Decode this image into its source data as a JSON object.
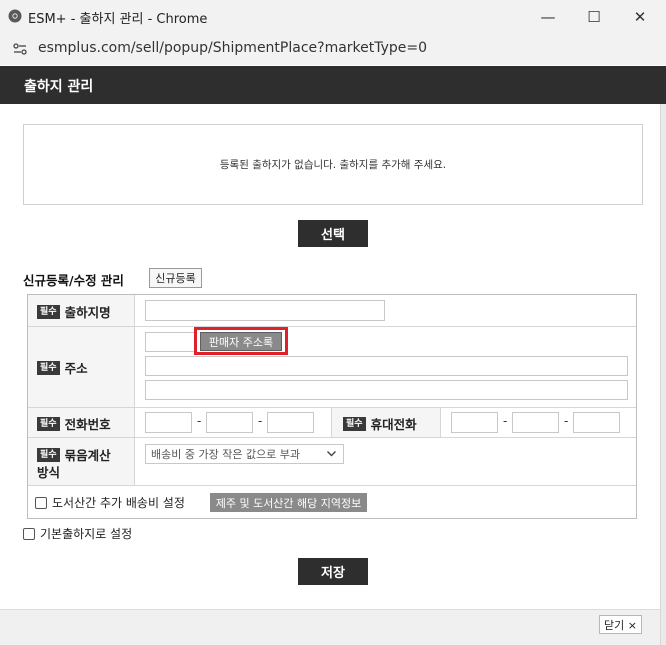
{
  "window": {
    "title": "ESM+ - 출하지 관리 - Chrome",
    "url": "esmplus.com/sell/popup/ShipmentPlace?marketType=0",
    "minimize": "—",
    "maximize": "☐",
    "close": "✕"
  },
  "header": {
    "title": "출하지 관리"
  },
  "list": {
    "empty_message": "등록된 출하지가 없습니다. 출하지를 추가해 주세요.",
    "select_label": "선택"
  },
  "form": {
    "section_title": "신규등록/수정 관리",
    "new_button": "신규등록",
    "required_badge": "필수",
    "name_label": "출하지명",
    "address_label": "주소",
    "address_book_button": "판매자 주소록",
    "phone_label": "전화번호",
    "mobile_label": "휴대전화",
    "phone_sep": "-",
    "bundle_label_line1": "묶음계산",
    "bundle_label_line2": "방식",
    "bundle_option": "배송비 중 가장 작은 값으로 부과",
    "island_checkbox_label": "도서산간 추가 배송비 설정",
    "region_info_button": "제주 및 도서산간 해당 지역정보",
    "default_checkbox_label": "기본출하지로 설정",
    "save_label": "저장"
  },
  "footer": {
    "close_label": "닫기 ×"
  }
}
